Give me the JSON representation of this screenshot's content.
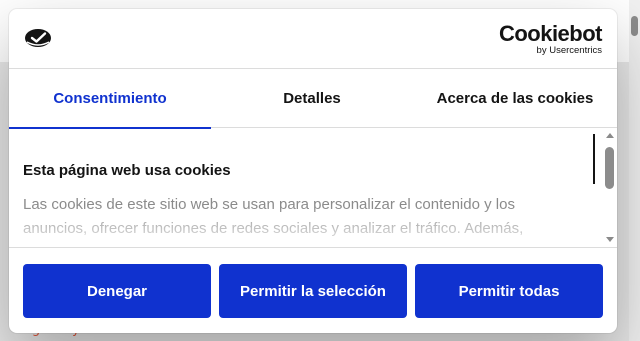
{
  "background": {
    "link_text": "Sigue leyendo"
  },
  "dialog": {
    "brand": "Cookiebot",
    "brand_sub": "by Usercentrics",
    "tabs": [
      {
        "label": "Consentimiento",
        "active": true
      },
      {
        "label": "Detalles",
        "active": false
      },
      {
        "label": "Acerca de las cookies",
        "active": false
      }
    ],
    "content": {
      "title": "Esta página web usa cookies",
      "text": "Las cookies de este sitio web se usan para personalizar el contenido y los anuncios, ofrecer funciones de redes sociales y analizar el tráfico. Además,"
    },
    "buttons": {
      "deny": "Denegar",
      "allow_selection": "Permitir la selección",
      "allow_all": "Permitir todas"
    }
  },
  "colors": {
    "accent": "#1032cf",
    "text": "#141414",
    "muted_text": "#8a8a8a",
    "link": "#e2583e"
  },
  "icons": [
    "brand-logo-icon",
    "chevron-up-icon",
    "chevron-down-icon"
  ]
}
